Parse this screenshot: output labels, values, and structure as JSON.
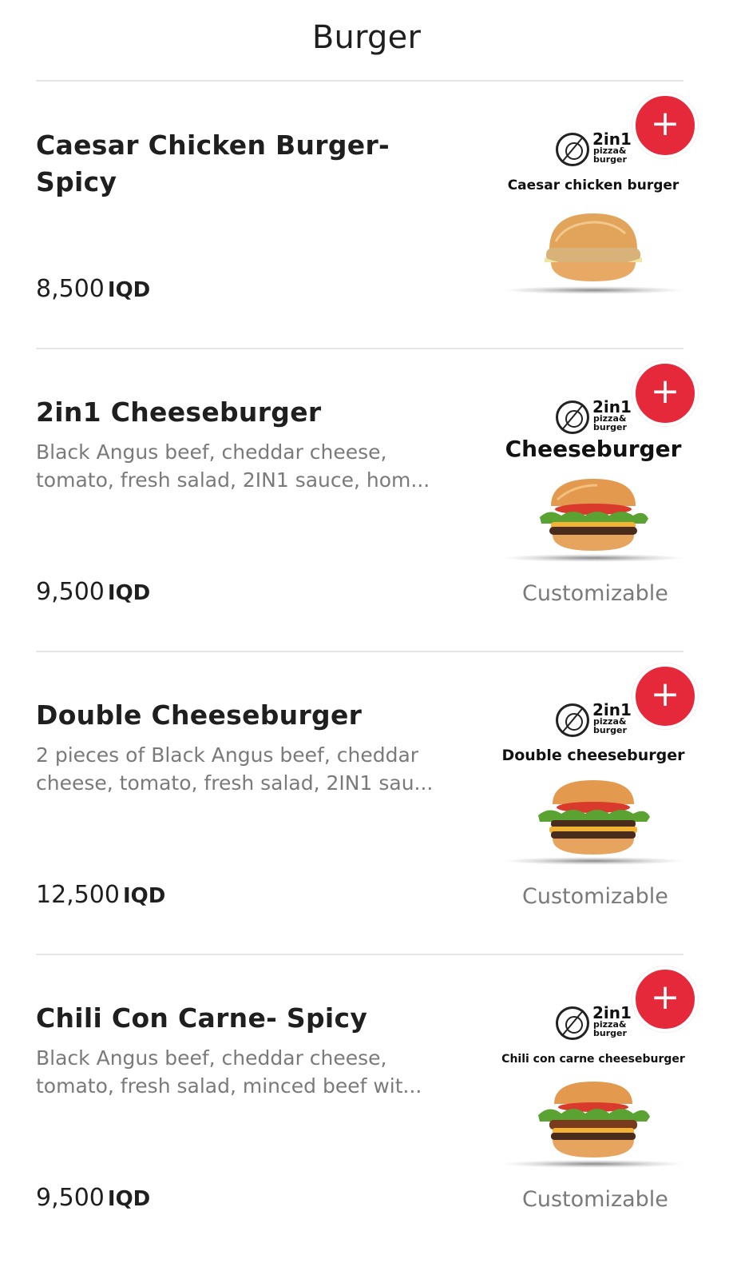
{
  "header": {
    "title": "Burger"
  },
  "brand": {
    "logo_top": "2in1",
    "logo_bottom_1": "pizza&",
    "logo_bottom_2": "burger"
  },
  "colors": {
    "accent": "#e5283a",
    "text": "#1f1f1f",
    "muted": "#7a7a7a",
    "divider": "#e6e6e6"
  },
  "items": [
    {
      "title_line1": "Caesar Chicken Burger-",
      "title_line2": "Spicy",
      "desc_line1": "",
      "desc_line2": "",
      "price": "8,500",
      "currency": "IQD",
      "image_caption": "Caesar chicken burger",
      "customizable": "",
      "add_icon": "plus-icon"
    },
    {
      "title_line1": "2in1 Cheeseburger",
      "title_line2": "",
      "desc_line1": "Black Angus beef, cheddar cheese,",
      "desc_line2": "tomato, fresh salad, 2IN1 sauce, hom...",
      "price": "9,500",
      "currency": "IQD",
      "image_caption": "Cheeseburger",
      "customizable": "Customizable",
      "add_icon": "plus-icon"
    },
    {
      "title_line1": "Double Cheeseburger",
      "title_line2": "",
      "desc_line1": "2 pieces of Black Angus beef, cheddar",
      "desc_line2": "cheese, tomato, fresh salad, 2IN1 sau...",
      "price": "12,500",
      "currency": "IQD",
      "image_caption": "Double cheeseburger",
      "customizable": "Customizable",
      "add_icon": "plus-icon"
    },
    {
      "title_line1": "Chili Con Carne- Spicy",
      "title_line2": "",
      "desc_line1": "Black Angus beef, cheddar cheese,",
      "desc_line2": "tomato, fresh salad, minced beef wit...",
      "price": "9,500",
      "currency": "IQD",
      "image_caption": "Chili con carne cheeseburger",
      "customizable": "Customizable",
      "add_icon": "plus-icon"
    }
  ]
}
